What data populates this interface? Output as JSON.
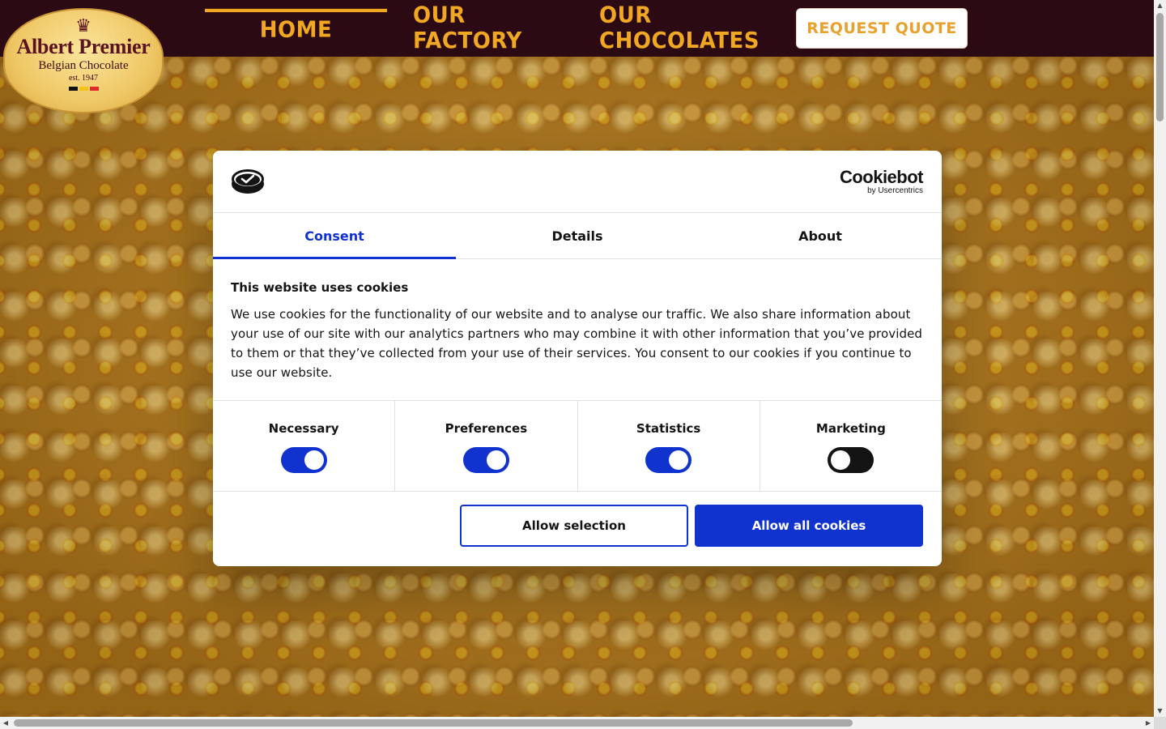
{
  "site": {
    "logo": {
      "crown_icon": "crown-icon",
      "brand": "Albert Premier",
      "tagline": "Belgian Chocolate",
      "established": "est. 1947",
      "flag_colors": [
        "#111111",
        "#f2c318",
        "#e02a2a"
      ]
    },
    "nav": {
      "home": "Home",
      "factory": "Our Factory",
      "chocolates": "Our Chocolates",
      "quote": "REQUEST QUOTE"
    }
  },
  "cookie_dialog": {
    "provider": {
      "name": "Cookiebot",
      "by": "by Usercentrics",
      "icon": "cookiebot-logo-icon"
    },
    "tabs": [
      {
        "label": "Consent",
        "active": true
      },
      {
        "label": "Details",
        "active": false
      },
      {
        "label": "About",
        "active": false
      }
    ],
    "title": "This website uses cookies",
    "body": "We use cookies for the functionality of our website and to analyse our traffic. We also share information about your use of our site with our analytics partners who may combine it with other information that you’ve provided to them or that they’ve collected from your use of their services. You consent to our cookies if you continue to use our website.",
    "categories": [
      {
        "label": "Necessary",
        "enabled": true
      },
      {
        "label": "Preferences",
        "enabled": true
      },
      {
        "label": "Statistics",
        "enabled": true
      },
      {
        "label": "Marketing",
        "enabled": false
      }
    ],
    "buttons": {
      "allow_selection": "Allow selection",
      "allow_all": "Allow all cookies"
    }
  },
  "colors": {
    "nav_bg": "#2c0a14",
    "nav_accent": "#f0a722",
    "cookiebot_blue": "#1032cf",
    "toggle_on": "#1032cf",
    "toggle_off": "#141414"
  }
}
